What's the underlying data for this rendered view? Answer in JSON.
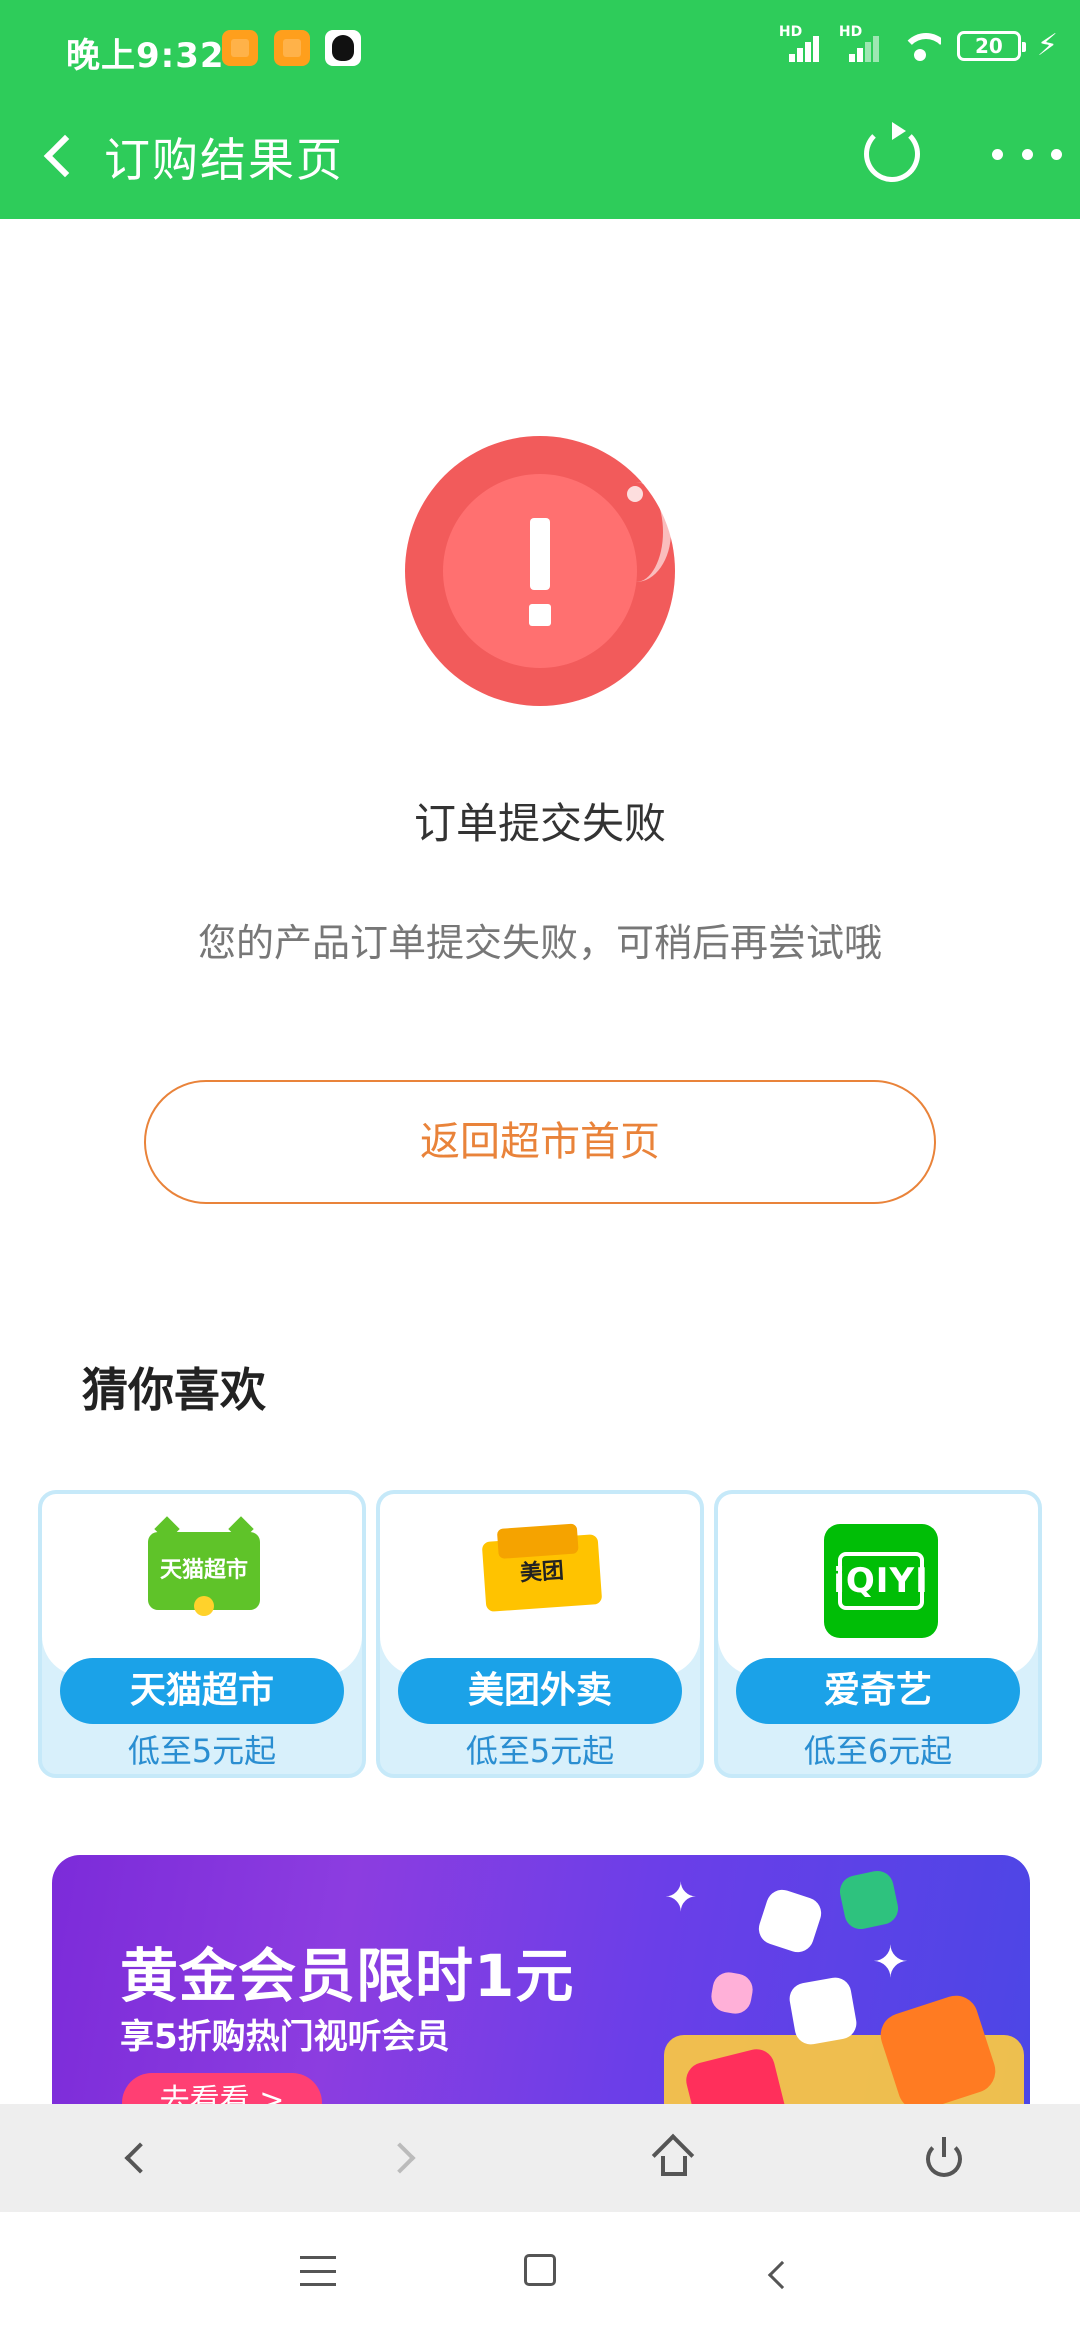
{
  "status_bar": {
    "time": "晚上9:32",
    "signal_label": "HD",
    "battery": "20",
    "charging_symbol": "⚡"
  },
  "header": {
    "title": "订购结果页"
  },
  "result": {
    "status": "订单提交失败",
    "message": "您的产品订单提交失败，可稍后再尝试哦",
    "return_button": "返回超市首页",
    "icon": "exclamation-icon",
    "status_color": "#f25b5b"
  },
  "recommend": {
    "title": "猜你喜欢",
    "items": [
      {
        "name": "天猫超市",
        "price": "低至5元起",
        "logo_text": "天猫超市",
        "icon": "tmall-supermarket-logo"
      },
      {
        "name": "美团外卖",
        "price": "低至5元起",
        "logo_text": "美团",
        "icon": "meituan-logo"
      },
      {
        "name": "爱奇艺",
        "price": "低至6元起",
        "logo_text": "iQIYI",
        "icon": "iqiyi-logo"
      }
    ]
  },
  "banner": {
    "title": "黄金会员限时1元",
    "subtitle": "享5折购热门视听会员",
    "button": "去看看 >"
  },
  "browser_toolbar": {
    "icons": [
      "back-icon",
      "forward-icon",
      "home-icon",
      "power-icon"
    ]
  },
  "system_nav": {
    "icons": [
      "menu-icon",
      "home-square-icon",
      "back-icon"
    ]
  },
  "colors": {
    "header_green": "#2ecc5a",
    "accent_orange": "#e9833a",
    "card_blue": "#1ba2e8"
  }
}
